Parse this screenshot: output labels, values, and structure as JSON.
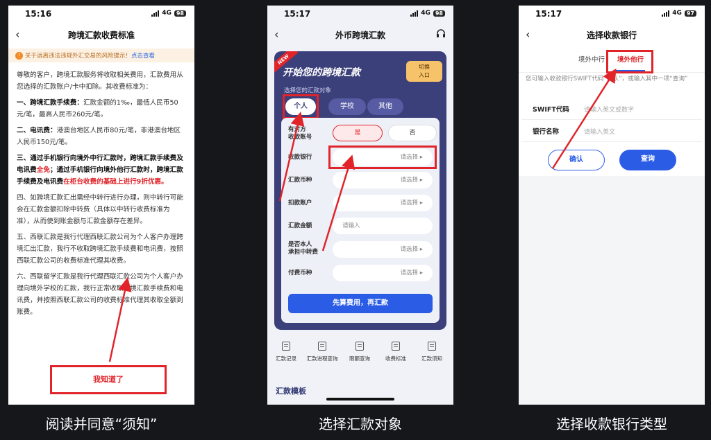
{
  "phone1": {
    "status": {
      "time": "15:16",
      "network": "4G",
      "battery": "98"
    },
    "nav": {
      "back": "‹",
      "title": "跨境汇款收费标准"
    },
    "warning": {
      "text": "关于远离违法违规外汇交易的风险提示！",
      "link": "点击查看"
    },
    "para1": "尊敬的客户，跨境汇款服务将收取相关费用，汇款费用从您选择的汇款账户/卡中扣除。其收费标准为：",
    "para2_bold": "一、跨境汇款手续费：",
    "para2_rest": "汇款金额的1‰，最低人民币50元/笔，最高人民币260元/笔。",
    "para3_bold": "二、电讯费：",
    "para3_rest": "港澳台地区人民币80元/笔，非港澳台地区人民币150元/笔。",
    "para4_a": "三、通过手机银行向境外中行汇款时，跨境汇款手续费及电讯费",
    "para4_red1": "全免",
    "para4_b": "；通过手机银行向境外他行汇款时，跨境汇款手续费及电讯费",
    "para4_red2": "在柜台收费的基础上进行9折优惠。",
    "para5": "四、如跨境汇款汇出需经中转行进行办理，则中转行可能会在汇款金额扣除中转费（具体以中转行收费标准为准），从而使到账金额与汇款金额存在差异。",
    "para6": "五、西联汇款是我行代理西联汇款公司为个人客户办理跨境汇出汇款，我行不收取跨境汇款手续费和电讯费，按照西联汇款公司的收费标准代理其收费。",
    "para7": "六、西联留学汇款是我行代理西联汇款公司为个人客户办理向境外学校的汇款，我行正常收取跨境汇款手续费和电讯费，并按照西联汇款公司的收费标准代理其收取全额到账费。",
    "ok_button": "我知道了",
    "caption": "阅读并同意“须知”"
  },
  "phone2": {
    "status": {
      "time": "15:17",
      "network": "4G",
      "battery": "98"
    },
    "nav": {
      "back": "‹",
      "title": "外币跨境汇款"
    },
    "card": {
      "new_badge": "NEW",
      "headline": "开始您的跨境汇款",
      "switch_label_1": "切换",
      "switch_label_2": "入口",
      "target_label": "选择您的汇款对象",
      "targets": [
        "个人",
        "学校",
        "其他"
      ]
    },
    "form": {
      "has_account_label_1": "有对方",
      "has_account_label_2": "收款账号",
      "yes": "是",
      "no": "否",
      "bank_label": "收款银行",
      "bank_value": "请选择 ▸",
      "currency_label": "汇款币种",
      "currency_value": "请选择 ▸",
      "debit_label": "扣款账户",
      "debit_value": "请选择 ▸",
      "amount_label": "汇款金额",
      "amount_placeholder": "请输入",
      "transit_label_1": "是否本人",
      "transit_label_2": "承担中转费",
      "transit_value": "请选择 ▸",
      "fee_label": "付费币种",
      "fee_value": "请选择 ▸",
      "submit": "先算费用，再汇款"
    },
    "tools": [
      "汇款记录",
      "汇款进程查询",
      "限额查询",
      "收费标准",
      "汇款须知"
    ],
    "template_title": "汇款模板",
    "caption": "选择汇款对象"
  },
  "phone3": {
    "status": {
      "time": "15:17",
      "network": "4G",
      "battery": "97"
    },
    "nav": {
      "back": "‹",
      "title": "选择收款银行"
    },
    "tabs": [
      "境外中行",
      "境外他行"
    ],
    "hint": "您可输入收款银行SWIFT代码“确认”，或输入其中一项“查询”",
    "swift_label": "SWIFT代码",
    "swift_placeholder": "请输入英文或数字",
    "bank_name_label": "银行名称",
    "bank_name_placeholder": "请输入英文",
    "confirm": "确认",
    "query": "查询",
    "caption": "选择收款银行类型"
  }
}
